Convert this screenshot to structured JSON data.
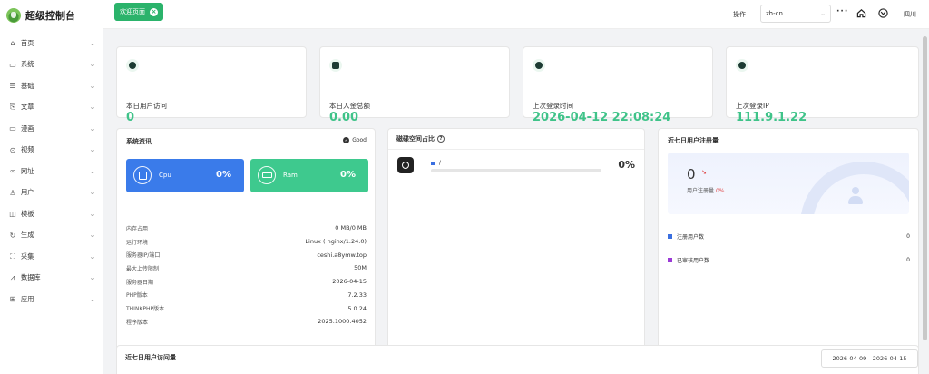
{
  "app": {
    "title": "超级控制台"
  },
  "sidebar": {
    "items": [
      {
        "label": "首页",
        "icon": "home-icon"
      },
      {
        "label": "系统",
        "icon": "monitor-icon"
      },
      {
        "label": "基础",
        "icon": "list-icon"
      },
      {
        "label": "文章",
        "icon": "article-icon"
      },
      {
        "label": "漫画",
        "icon": "comic-icon"
      },
      {
        "label": "视频",
        "icon": "video-icon"
      },
      {
        "label": "网址",
        "icon": "link-icon"
      },
      {
        "label": "用户",
        "icon": "user-icon"
      },
      {
        "label": "模板",
        "icon": "template-icon"
      },
      {
        "label": "生成",
        "icon": "generate-icon"
      },
      {
        "label": "采集",
        "icon": "collect-icon"
      },
      {
        "label": "数据库",
        "icon": "database-icon"
      },
      {
        "label": "应用",
        "icon": "app-icon"
      }
    ]
  },
  "topbar": {
    "tab_label": "欢迎页面",
    "operation": "操作",
    "language": "zh-cn",
    "more": "···",
    "region": "四川"
  },
  "stats": [
    {
      "label": "本日用户访问",
      "value": "0",
      "icon": "user-visit-icon"
    },
    {
      "label": "本日入金总额",
      "value": "0.00",
      "icon": "wallet-icon"
    },
    {
      "label": "上次登录时间",
      "value": "2026-04-12 22:08:24",
      "icon": "clock-icon"
    },
    {
      "label": "上次登录IP",
      "value": "111.9.1.22",
      "icon": "location-icon"
    }
  ],
  "system": {
    "title": "系统资讯",
    "status": "Good",
    "cpu": {
      "label": "Cpu",
      "value": "0%"
    },
    "ram": {
      "label": "Ram",
      "value": "0%"
    },
    "info": [
      {
        "key": "内存占用",
        "value": "0 MB/0 MB"
      },
      {
        "key": "运行环境",
        "value": "Linux ( nginx/1.24.0)"
      },
      {
        "key": "服务器IP/端口",
        "value": "ceshi.a8ymw.top"
      },
      {
        "key": "最大上传限制",
        "value": "50M"
      },
      {
        "key": "服务器日期",
        "value": "2026-04-15"
      },
      {
        "key": "PHP版本",
        "value": "7.2.33"
      },
      {
        "key": "THINKPHP版本",
        "value": "5.0.24"
      },
      {
        "key": "程序版本",
        "value": "2025.1000.4052"
      }
    ]
  },
  "disk": {
    "title": "磁碟空间占比",
    "mount": "/",
    "percent_label": "0%",
    "percent": 0
  },
  "registrations": {
    "title": "近七日用户注册量",
    "count": "0",
    "label": "用户注册量",
    "percent": "0%",
    "rows": [
      {
        "label": "注册用户数",
        "value": "0",
        "color": "#3a6fe0"
      },
      {
        "label": "已审核用户数",
        "value": "0",
        "color": "#9b3ad6"
      }
    ]
  },
  "visits": {
    "title": "近七日用户访问量",
    "date_range": "2026-04-09 - 2026-04-15"
  },
  "colors": {
    "accent": "#2bb36b",
    "stat_value": "#3fc389",
    "cpu": "#3a7bea",
    "ram": "#3ec98e"
  }
}
